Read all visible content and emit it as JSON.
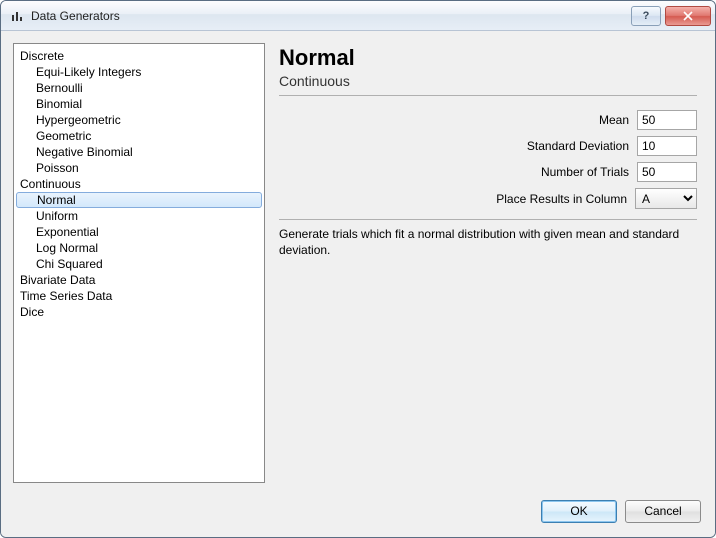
{
  "window": {
    "title": "Data Generators"
  },
  "tree": {
    "categories": [
      {
        "label": "Discrete",
        "items": [
          "Equi-Likely Integers",
          "Bernoulli",
          "Binomial",
          "Hypergeometric",
          "Geometric",
          "Negative Binomial",
          "Poisson"
        ]
      },
      {
        "label": "Continuous",
        "items": [
          "Normal",
          "Uniform",
          "Exponential",
          "Log Normal",
          "Chi Squared"
        ]
      },
      {
        "label": "Bivariate Data",
        "items": []
      },
      {
        "label": "Time Series Data",
        "items": []
      },
      {
        "label": "Dice",
        "items": []
      }
    ],
    "selected": "Normal"
  },
  "details": {
    "title": "Normal",
    "subtitle": "Continuous",
    "fields": {
      "mean": {
        "label": "Mean",
        "value": "50"
      },
      "sd": {
        "label": "Standard Deviation",
        "value": "10"
      },
      "trials": {
        "label": "Number of Trials",
        "value": "50"
      },
      "column": {
        "label": "Place Results in Column",
        "value": "A"
      }
    },
    "description": "Generate trials which fit a normal distribution with given mean and standard deviation."
  },
  "buttons": {
    "ok": "OK",
    "cancel": "Cancel"
  }
}
